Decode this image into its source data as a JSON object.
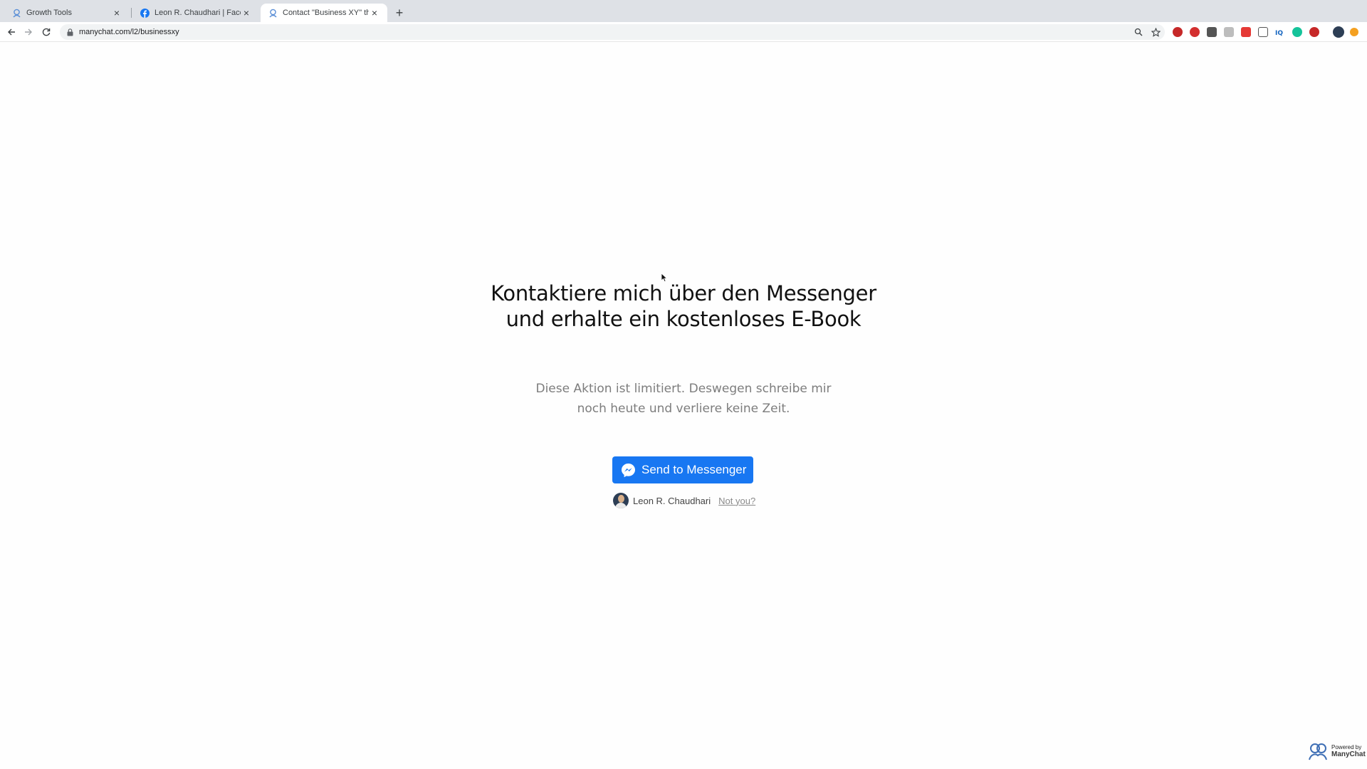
{
  "browser": {
    "tabs": [
      {
        "title": "Growth Tools",
        "favicon": "manychat-icon",
        "active": false
      },
      {
        "title": "Leon R. Chaudhari | Facebook",
        "favicon": "facebook-icon",
        "active": false
      },
      {
        "title": "Contact \"Business XY\" through",
        "favicon": "manychat-icon",
        "active": true
      }
    ],
    "close_glyph": "×",
    "new_tab_glyph": "+",
    "url": "manychat.com/l2/businessxy"
  },
  "page": {
    "headline": "Kontaktiere mich über den Messenger und erhalte ein kostenloses E-Book",
    "subtitle": "Diese Aktion ist limitiert. Deswegen schreibe mir noch heute und verliere keine Zeit.",
    "button_label": "Send to Messenger",
    "user_name": "Leon R. Chaudhari",
    "not_you": "Not you?"
  },
  "footer": {
    "powered_by": "Powered by",
    "brand": "ManyChat"
  },
  "colors": {
    "messenger_blue": "#1877f2",
    "tab_strip": "#dee1e6"
  }
}
